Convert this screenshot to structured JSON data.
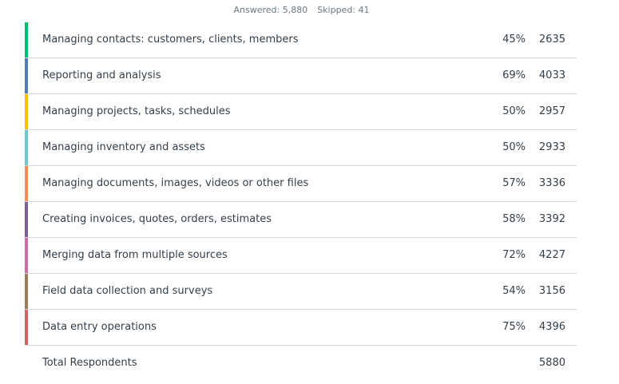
{
  "summary": {
    "answered": "Answered: 5,880",
    "skipped": "Skipped: 41"
  },
  "chart_data": {
    "type": "table",
    "categories": [
      "Managing contacts: customers, clients, members",
      "Reporting and analysis",
      "Managing projects, tasks, schedules",
      "Managing inventory and assets",
      "Managing documents, images, videos or other files",
      "Creating invoices, quotes, orders, estimates",
      "Merging data from multiple sources",
      "Field data collection and surveys",
      "Data entry operations"
    ],
    "percents": [
      "45%",
      "69%",
      "50%",
      "50%",
      "57%",
      "58%",
      "72%",
      "54%",
      "75%"
    ],
    "values": [
      2635,
      4033,
      2957,
      2933,
      3336,
      3392,
      4227,
      3156,
      4396
    ],
    "colors": [
      "#00bf6f",
      "#507cb6",
      "#f9be00",
      "#6bc8cd",
      "#ff8b4f",
      "#7f6096",
      "#ce6aa5",
      "#9a7f5e",
      "#d25f5f"
    ],
    "total_label": "Total Respondents",
    "total_value": "5880"
  }
}
